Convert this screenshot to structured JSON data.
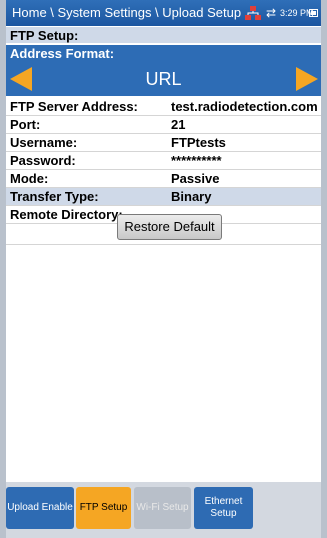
{
  "titlebar": {
    "breadcrumb": "Home \\ System Settings \\ Upload Setup",
    "time": "3:29 PM"
  },
  "section_title": "FTP Setup:",
  "address_format": {
    "label": "Address Format:",
    "value": "URL"
  },
  "fields": [
    {
      "label": "FTP Server Address:",
      "value": "test.radiodetection.com"
    },
    {
      "label": "Port:",
      "value": "21"
    },
    {
      "label": "Username:",
      "value": "FTPtests"
    },
    {
      "label": "Password:",
      "value": "**********"
    },
    {
      "label": "Mode:",
      "value": "Passive"
    },
    {
      "label": "Transfer Type:",
      "value": "Binary"
    },
    {
      "label": "Remote Directory:",
      "value": ""
    }
  ],
  "restore_button": "Restore Default",
  "tabs": [
    {
      "label": "Upload Enable"
    },
    {
      "label": "FTP Setup"
    },
    {
      "label": "Wi-Fi Setup"
    },
    {
      "label": "Ethernet Setup"
    }
  ],
  "colors": {
    "header_blue": "#2d6cb5",
    "highlight": "#cfd9e8",
    "active_tab": "#f5a623",
    "arrow": "#f5a623"
  },
  "icons": [
    "network-icon",
    "transfer-arrows-icon",
    "battery-icon",
    "left-arrow-icon",
    "right-arrow-icon"
  ]
}
